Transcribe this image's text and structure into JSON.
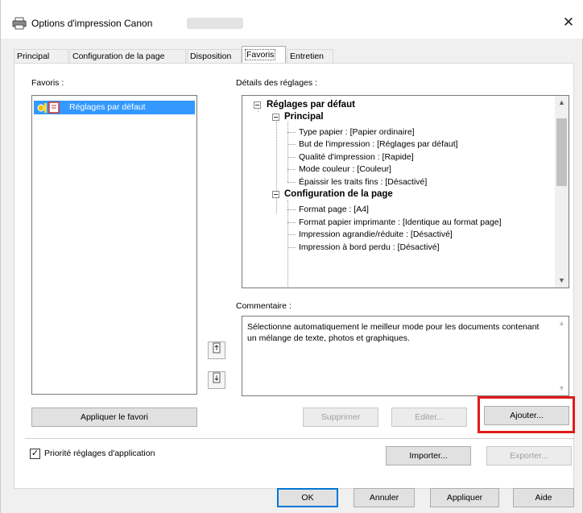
{
  "window": {
    "title": "Options d'impression Canon",
    "close_label": "✕"
  },
  "tabs": [
    {
      "label": "Principal"
    },
    {
      "label": "Configuration de la page"
    },
    {
      "label": "Disposition"
    },
    {
      "label": "Favoris",
      "active": true
    },
    {
      "label": "Entretien"
    }
  ],
  "favorites": {
    "label": "Favoris :",
    "items": [
      {
        "label": "Réglages par défaut",
        "selected": true
      }
    ],
    "apply_button": "Appliquer le favori"
  },
  "details": {
    "label": "Détails des réglages :",
    "tree": {
      "root": "Réglages par défaut",
      "group1": "Principal",
      "g1_items": [
        "Type papier : [Papier ordinaire]",
        "But de l'impression : [Réglages par défaut]",
        "Qualité d'impression : [Rapide]",
        "Mode couleur : [Couleur]",
        "Épaissir les traits fins : [Désactivé]"
      ],
      "group2": "Configuration de la page",
      "g2_items": [
        "Format page : [A4]",
        "Format papier imprimante : [Identique au format page]",
        "Impression agrandie/réduite : [Désactivé]",
        "Impression à bord perdu : [Désactivé]"
      ]
    }
  },
  "comment": {
    "label": "Commentaire :",
    "text": "Sélectionne automatiquement le meilleur mode pour les documents contenant un mélange de texte, photos et graphiques."
  },
  "buttons": {
    "delete": "Supprimer",
    "edit": "Editer...",
    "add": "Ajouter...",
    "import": "Importer...",
    "export": "Exporter...",
    "ok": "OK",
    "cancel": "Annuler",
    "apply": "Appliquer",
    "help": "Aide"
  },
  "priority": {
    "label": "Priorité réglages d'application",
    "checked": true
  },
  "colors": {
    "selection": "#3399ff",
    "highlight_box": "#e21b1b",
    "default_button_border": "#0078d7"
  }
}
